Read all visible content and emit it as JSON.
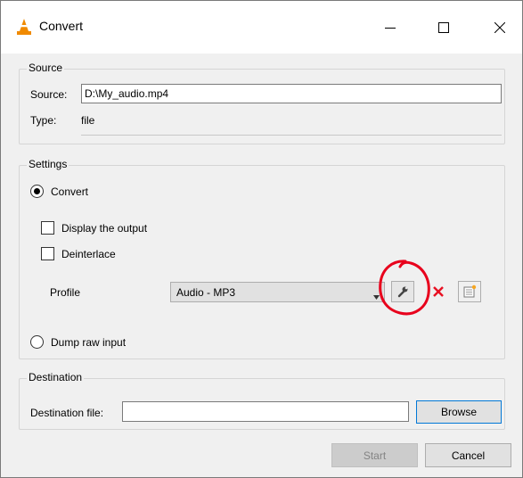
{
  "window": {
    "title": "Convert",
    "controls": {
      "minimize": "—",
      "maximize": "☐",
      "close": "✕"
    }
  },
  "source": {
    "group_label": "Source",
    "source_label": "Source:",
    "source_value": "D:\\My_audio.mp4",
    "type_label": "Type:",
    "type_value": "file"
  },
  "settings": {
    "group_label": "Settings",
    "convert_label": "Convert",
    "convert_selected": true,
    "display_output_label": "Display the output",
    "display_output_checked": false,
    "deinterlace_label": "Deinterlace",
    "deinterlace_checked": false,
    "profile_label": "Profile",
    "profile_value": "Audio - MP3",
    "profile_buttons": [
      "wrench-icon",
      "delete-x-icon",
      "new-profile-icon"
    ],
    "dump_raw_label": "Dump raw input",
    "dump_raw_selected": false
  },
  "destination": {
    "group_label": "Destination",
    "file_label": "Destination file:",
    "file_value": "",
    "browse_label": "Browse"
  },
  "footer": {
    "start_label": "Start",
    "start_enabled": false,
    "cancel_label": "Cancel"
  },
  "annotation": {
    "shape": "hand-drawn-circle",
    "color": "#e8001c"
  },
  "colors": {
    "accent": "#0078d7",
    "delete_red": "#e81123",
    "vlc_orange": "#f08a00"
  }
}
